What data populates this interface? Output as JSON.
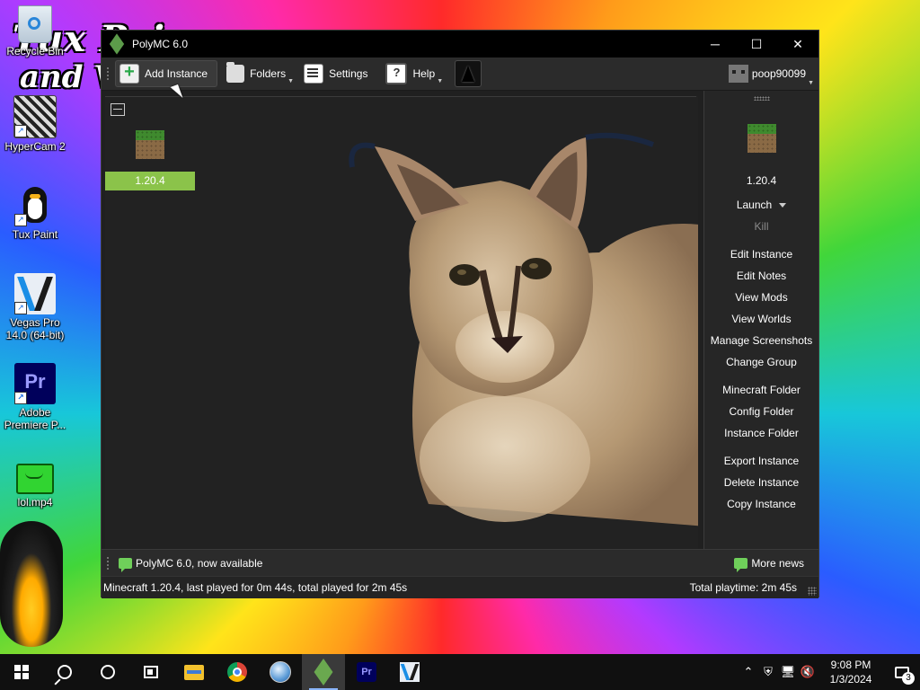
{
  "desktop": {
    "icons": [
      {
        "label": "Recycle Bin"
      },
      {
        "label": "HyperCam 2"
      },
      {
        "label": "Tux Paint"
      },
      {
        "label": "Vegas Pro\n14.0 (64-bit)"
      },
      {
        "label": "Adobe\nPremiere P..."
      },
      {
        "label": "lol.mp4"
      }
    ],
    "wallpaper_text_1": "Tux Pai",
    "wallpaper_text_2": "and Ve"
  },
  "window": {
    "title": "PolyMC 6.0",
    "controls": {
      "minimize": "─",
      "maximize": "☐",
      "close": "✕"
    }
  },
  "toolbar": {
    "add_instance": "Add Instance",
    "folders": "Folders",
    "settings": "Settings",
    "help": "Help",
    "account": "poop90099"
  },
  "instances": [
    {
      "name": "1.20.4"
    }
  ],
  "side_panel": {
    "instance_name": "1.20.4",
    "launch": "Launch",
    "kill": "Kill",
    "group1": [
      "Edit Instance",
      "Edit Notes",
      "View Mods",
      "View Worlds",
      "Manage Screenshots",
      "Change Group"
    ],
    "group2": [
      "Minecraft Folder",
      "Config Folder",
      "Instance Folder"
    ],
    "group3": [
      "Export Instance",
      "Delete Instance",
      "Copy Instance"
    ]
  },
  "news": {
    "headline": "PolyMC 6.0, now available",
    "more": "More news"
  },
  "status": {
    "left": "Minecraft 1.20.4, last played for 0m 44s, total played for 2m 45s",
    "right": "Total playtime: 2m 45s"
  },
  "taskbar": {
    "clock_time": "9:08 PM",
    "clock_date": "1/3/2024",
    "notification_count": "3",
    "premiere_label": "Pr"
  },
  "colors": {
    "accent_green": "#8bc34a",
    "window_bg": "#202020",
    "titlebar_bg": "#000000"
  }
}
